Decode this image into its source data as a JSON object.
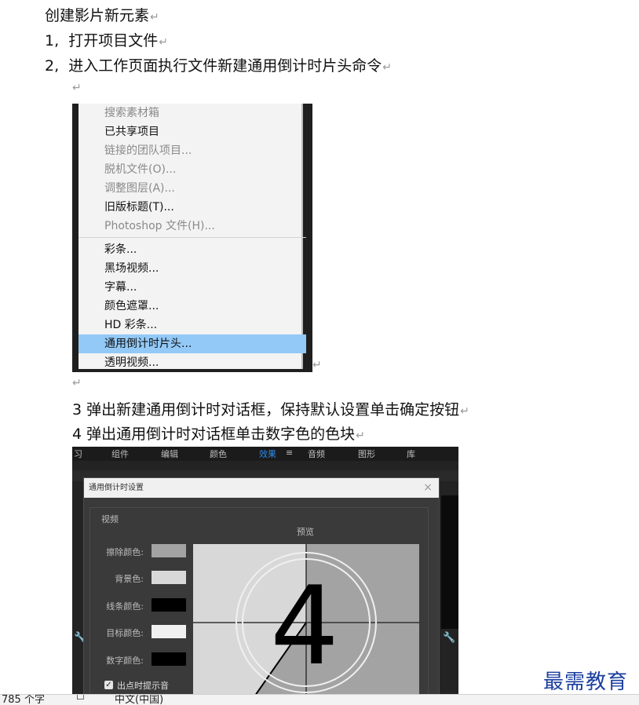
{
  "doc": {
    "title": "创建影片新元素",
    "step1": "1,  打开项目文件",
    "step2": "2,  进入工作页面执行文件新建通用倒计时片头命令",
    "step3": "3 弹出新建通用倒计时对话框，保持默认设置单击确定按钮",
    "step4": "4 弹出通用倒计时对话框单击数字色的色块",
    "return_mark": "↵"
  },
  "menu": {
    "items_top": [
      {
        "label": "搜索素材箱",
        "disabled": true
      },
      {
        "label": "已共享项目",
        "disabled": false
      },
      {
        "label": "链接的团队项目...",
        "disabled": true
      },
      {
        "label": "脱机文件(O)...",
        "disabled": true
      },
      {
        "label": "调整图层(A)...",
        "disabled": true
      },
      {
        "label": "旧版标题(T)...",
        "disabled": false
      },
      {
        "label": "Photoshop 文件(H)...",
        "disabled": true
      }
    ],
    "items_bottom": [
      {
        "label": "彩条...",
        "selected": false
      },
      {
        "label": "黑场视频...",
        "selected": false
      },
      {
        "label": "字幕...",
        "selected": false
      },
      {
        "label": "颜色遮罩...",
        "selected": false
      },
      {
        "label": "HD 彩条...",
        "selected": false
      },
      {
        "label": "通用倒计时片头...",
        "selected": true
      },
      {
        "label": "透明视频...",
        "selected": false
      }
    ]
  },
  "app_tabs": [
    {
      "label": "习",
      "active": false
    },
    {
      "label": "组件",
      "active": false
    },
    {
      "label": "编辑",
      "active": false
    },
    {
      "label": "颜色",
      "active": false
    },
    {
      "label": "效果",
      "active": true
    },
    {
      "label": "≡",
      "active": false
    },
    {
      "label": "音频",
      "active": false
    },
    {
      "label": "图形",
      "active": false
    },
    {
      "label": "库",
      "active": false
    }
  ],
  "dialog": {
    "title": "通用倒计时设置",
    "close": "×",
    "group_label": "视频",
    "preview_label": "预览",
    "rows": [
      {
        "label": "擦除颜色:",
        "color": "#a3a3a3"
      },
      {
        "label": "背景色:",
        "color": "#d8d8d8"
      },
      {
        "label": "线条颜色:",
        "color": "#000000"
      },
      {
        "label": "目标颜色:",
        "color": "#f0f0f0"
      },
      {
        "label": "数字颜色:",
        "color": "#000000"
      }
    ],
    "checkbox_label": "出点时提示音",
    "checkbox_checked": true,
    "preview_digit": "4"
  },
  "logo": "最需教育",
  "statusbar": {
    "words": "785 个字",
    "language": "中文(中国)"
  }
}
